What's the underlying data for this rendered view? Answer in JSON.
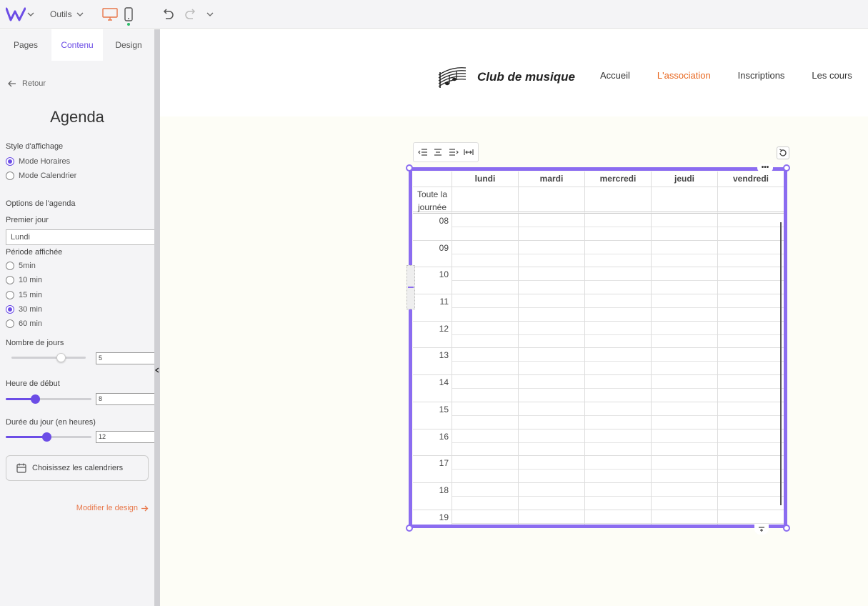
{
  "topbar": {
    "tools_label": "Outils"
  },
  "panel": {
    "tabs": [
      "Pages",
      "Contenu",
      "Design"
    ],
    "active_tab": "Contenu",
    "back_label": "Retour",
    "title": "Agenda",
    "display_style_label": "Style d'affichage",
    "display_options": [
      "Mode Horaires",
      "Mode Calendrier"
    ],
    "display_selected": "Mode Horaires",
    "options_label": "Options de l'agenda",
    "first_day_label": "Premier jour",
    "first_day_value": "Lundi",
    "period_label": "Période affichée",
    "period_options": [
      "5min",
      "10 min",
      "15 min",
      "30 min",
      "60 min"
    ],
    "period_selected": "30 min",
    "days_label": "Nombre de jours",
    "days_value": "5",
    "start_label": "Heure de début",
    "start_value": "8",
    "duration_label": "Durée du jour (en heures)",
    "duration_value": "12",
    "calendars_button": "Choisissez les calendriers",
    "design_link": "Modifier le design"
  },
  "site": {
    "brand": "Club de musique",
    "nav": [
      "Accueil",
      "L'association",
      "Inscriptions",
      "Les cours"
    ],
    "nav_active": "L'association",
    "accent_color": "#e8661e"
  },
  "agenda": {
    "days": [
      "lundi",
      "mardi",
      "mercredi",
      "jeudi",
      "vendredi"
    ],
    "all_day_label": "Toute la journée",
    "hours": [
      "08",
      "09",
      "10",
      "11",
      "12",
      "13",
      "14",
      "15",
      "16",
      "17",
      "18",
      "19"
    ],
    "frame_color": "#8b6cf0"
  }
}
